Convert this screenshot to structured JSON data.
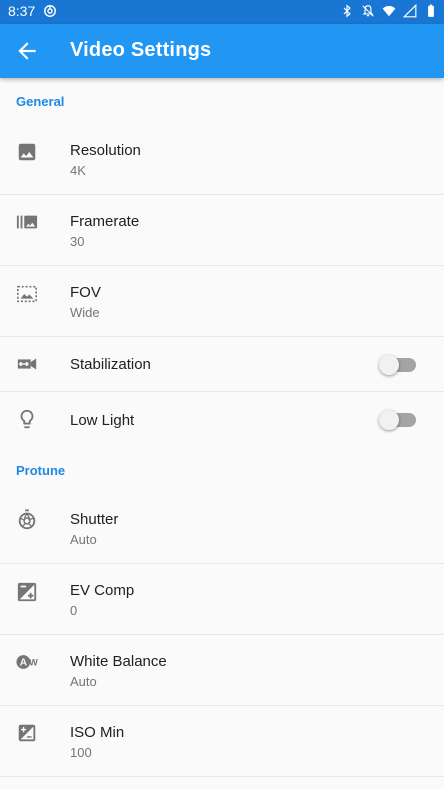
{
  "status_bar": {
    "time": "8:37"
  },
  "app_bar": {
    "title": "Video Settings"
  },
  "sections": {
    "general": {
      "header": "General"
    },
    "protune": {
      "header": "Protune"
    }
  },
  "settings": {
    "resolution": {
      "label": "Resolution",
      "value": "4K",
      "icon": "image-icon"
    },
    "framerate": {
      "label": "Framerate",
      "value": "30",
      "icon": "burst-mode-icon"
    },
    "fov": {
      "label": "FOV",
      "value": "Wide",
      "icon": "crop-free-image-icon"
    },
    "stabilization": {
      "label": "Stabilization",
      "enabled": false,
      "icon": "video-stabilization-icon"
    },
    "low_light": {
      "label": "Low Light",
      "enabled": false,
      "icon": "lightbulb-icon"
    },
    "shutter": {
      "label": "Shutter",
      "value": "Auto",
      "icon": "shutter-icon"
    },
    "ev_comp": {
      "label": "EV Comp",
      "value": "0",
      "icon": "exposure-icon"
    },
    "white_balance": {
      "label": "White Balance",
      "value": "Auto",
      "icon": "white-balance-auto-icon"
    },
    "iso_min": {
      "label": "ISO Min",
      "value": "100",
      "icon": "iso-icon"
    }
  },
  "colors": {
    "status_bar": "#1976d2",
    "app_bar": "#2196f3",
    "section_header": "#1e88e5",
    "icon": "#757575"
  }
}
